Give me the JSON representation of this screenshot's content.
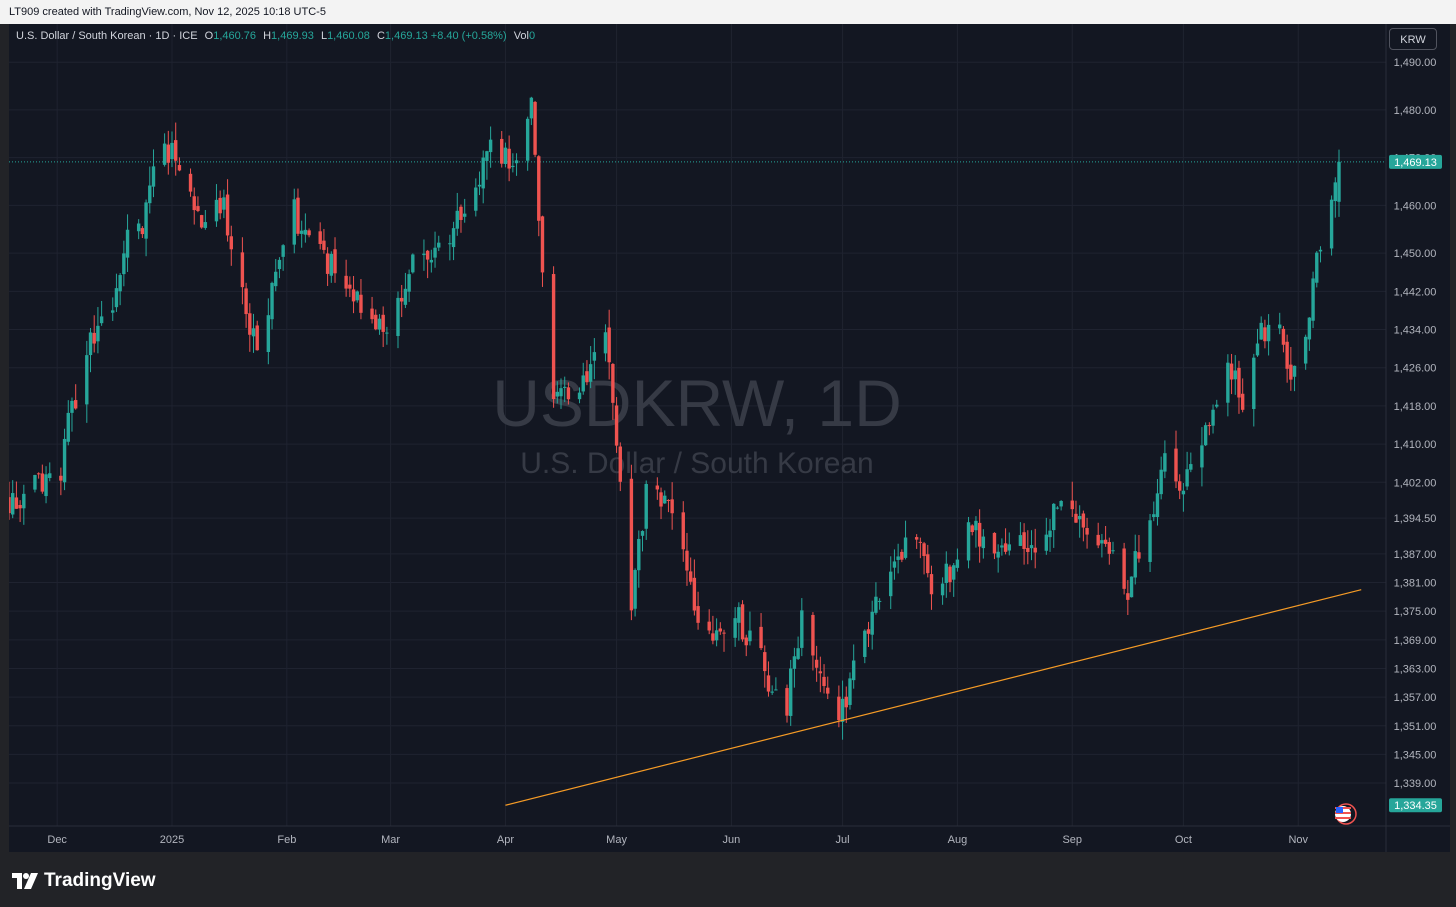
{
  "header": {
    "caption": "LT909 created with TradingView.com, Nov 12, 2025 10:18 UTC-5"
  },
  "legend": {
    "symbol": "U.S. Dollar / South Korean · 1D · ICE",
    "open_label": "O",
    "open": "1,460.76",
    "high_label": "H",
    "high": "1,469.93",
    "low_label": "L",
    "low": "1,460.08",
    "close_label": "C",
    "close": "1,469.13",
    "change": "+8.40 (+0.58%)",
    "vol_label": "Vol",
    "vol": "0"
  },
  "currency_button": "KRW",
  "watermark": {
    "line1": "USDKRW, 1D",
    "line2": "U.S. Dollar / South Korean"
  },
  "footer": {
    "brand": "TradingView"
  },
  "colors": {
    "up": "#26a69a",
    "down": "#ef5350",
    "trendline": "#f59b26",
    "background": "#131722",
    "grid": "#1f2330",
    "axis_text": "#b2b5be"
  },
  "chart_data": {
    "type": "candlestick",
    "x_range": [
      "2024-11-18",
      "2025-11-12"
    ],
    "y_range": [
      1330.0,
      1498.0
    ],
    "y_ticks": [
      "1,490.00",
      "1,480.00",
      "1,470.00",
      "1,460.00",
      "1,450.00",
      "1,442.00",
      "1,434.00",
      "1,426.00",
      "1,418.00",
      "1,410.00",
      "1,402.00",
      "1,394.50",
      "1,387.00",
      "1,381.00",
      "1,375.00",
      "1,369.00",
      "1,363.00",
      "1,357.00",
      "1,351.00",
      "1,345.00",
      "1,339.00"
    ],
    "x_ticks": [
      {
        "label": "Dec",
        "date": "2024-12-01"
      },
      {
        "label": "2025",
        "date": "2025-01-01"
      },
      {
        "label": "Feb",
        "date": "2025-02-01"
      },
      {
        "label": "Mar",
        "date": "2025-03-01"
      },
      {
        "label": "Apr",
        "date": "2025-04-01"
      },
      {
        "label": "May",
        "date": "2025-05-01"
      },
      {
        "label": "Jun",
        "date": "2025-06-01"
      },
      {
        "label": "Jul",
        "date": "2025-07-01"
      },
      {
        "label": "Aug",
        "date": "2025-08-01"
      },
      {
        "label": "Sep",
        "date": "2025-09-01"
      },
      {
        "label": "Oct",
        "date": "2025-10-01"
      },
      {
        "label": "Nov",
        "date": "2025-11-01"
      }
    ],
    "last_price": {
      "value": 1469.13,
      "label": "1,469.13"
    },
    "low_marker": {
      "value": 1334.35,
      "label": "1,334.35"
    },
    "trendline": {
      "start": {
        "date": "2025-04-01",
        "value": 1334.35
      },
      "end": {
        "date": "2025-11-18",
        "value": 1379.5
      }
    },
    "anchors": [
      {
        "date": "2024-11-18",
        "close": 1398
      },
      {
        "date": "2024-11-25",
        "close": 1401
      },
      {
        "date": "2024-12-02",
        "close": 1404
      },
      {
        "date": "2024-12-04",
        "close": 1415
      },
      {
        "date": "2024-12-06",
        "close": 1418
      },
      {
        "date": "2024-12-10",
        "close": 1433
      },
      {
        "date": "2024-12-16",
        "close": 1436
      },
      {
        "date": "2024-12-19",
        "close": 1451
      },
      {
        "date": "2024-12-24",
        "close": 1456
      },
      {
        "date": "2024-12-27",
        "close": 1470
      },
      {
        "date": "2024-12-30",
        "close": 1472
      },
      {
        "date": "2025-01-03",
        "close": 1470
      },
      {
        "date": "2025-01-08",
        "close": 1458
      },
      {
        "date": "2025-01-15",
        "close": 1460
      },
      {
        "date": "2025-01-20",
        "close": 1440
      },
      {
        "date": "2025-01-24",
        "close": 1431
      },
      {
        "date": "2025-02-03",
        "close": 1459
      },
      {
        "date": "2025-02-07",
        "close": 1451
      },
      {
        "date": "2025-02-14",
        "close": 1447
      },
      {
        "date": "2025-02-21",
        "close": 1440
      },
      {
        "date": "2025-02-28",
        "close": 1433
      },
      {
        "date": "2025-03-07",
        "close": 1448
      },
      {
        "date": "2025-03-14",
        "close": 1452
      },
      {
        "date": "2025-03-21",
        "close": 1458
      },
      {
        "date": "2025-03-28",
        "close": 1472
      },
      {
        "date": "2025-04-03",
        "close": 1468
      },
      {
        "date": "2025-04-08",
        "close": 1484
      },
      {
        "date": "2025-04-10",
        "close": 1456
      },
      {
        "date": "2025-04-14",
        "close": 1420
      },
      {
        "date": "2025-04-21",
        "close": 1423
      },
      {
        "date": "2025-04-28",
        "close": 1433
      },
      {
        "date": "2025-05-02",
        "close": 1404
      },
      {
        "date": "2025-05-05",
        "close": 1378
      },
      {
        "date": "2025-05-09",
        "close": 1399
      },
      {
        "date": "2025-05-14",
        "close": 1398
      },
      {
        "date": "2025-05-20",
        "close": 1385
      },
      {
        "date": "2025-05-23",
        "close": 1372
      },
      {
        "date": "2025-05-29",
        "close": 1368
      },
      {
        "date": "2025-06-03",
        "close": 1373
      },
      {
        "date": "2025-06-09",
        "close": 1365
      },
      {
        "date": "2025-06-12",
        "close": 1357
      },
      {
        "date": "2025-06-16",
        "close": 1355
      },
      {
        "date": "2025-06-20",
        "close": 1375
      },
      {
        "date": "2025-06-25",
        "close": 1363
      },
      {
        "date": "2025-06-30",
        "close": 1351
      },
      {
        "date": "2025-07-03",
        "close": 1360
      },
      {
        "date": "2025-07-07",
        "close": 1369
      },
      {
        "date": "2025-07-11",
        "close": 1378
      },
      {
        "date": "2025-07-16",
        "close": 1387
      },
      {
        "date": "2025-07-21",
        "close": 1390
      },
      {
        "date": "2025-07-25",
        "close": 1378
      },
      {
        "date": "2025-07-30",
        "close": 1383
      },
      {
        "date": "2025-08-04",
        "close": 1394
      },
      {
        "date": "2025-08-08",
        "close": 1388
      },
      {
        "date": "2025-08-14",
        "close": 1390
      },
      {
        "date": "2025-08-20",
        "close": 1387
      },
      {
        "date": "2025-08-25",
        "close": 1394
      },
      {
        "date": "2025-08-29",
        "close": 1396
      },
      {
        "date": "2025-09-03",
        "close": 1393
      },
      {
        "date": "2025-09-08",
        "close": 1390
      },
      {
        "date": "2025-09-12",
        "close": 1389
      },
      {
        "date": "2025-09-16",
        "close": 1380
      },
      {
        "date": "2025-09-18",
        "close": 1387
      },
      {
        "date": "2025-09-22",
        "close": 1395
      },
      {
        "date": "2025-09-26",
        "close": 1408
      },
      {
        "date": "2025-09-30",
        "close": 1402
      },
      {
        "date": "2025-10-06",
        "close": 1408
      },
      {
        "date": "2025-10-10",
        "close": 1420
      },
      {
        "date": "2025-10-14",
        "close": 1426
      },
      {
        "date": "2025-10-17",
        "close": 1418
      },
      {
        "date": "2025-10-22",
        "close": 1433
      },
      {
        "date": "2025-10-27",
        "close": 1434
      },
      {
        "date": "2025-10-30",
        "close": 1424
      },
      {
        "date": "2025-11-03",
        "close": 1431
      },
      {
        "date": "2025-11-06",
        "close": 1448
      },
      {
        "date": "2025-11-10",
        "close": 1460
      },
      {
        "date": "2025-11-12",
        "close": 1469.13
      }
    ]
  }
}
